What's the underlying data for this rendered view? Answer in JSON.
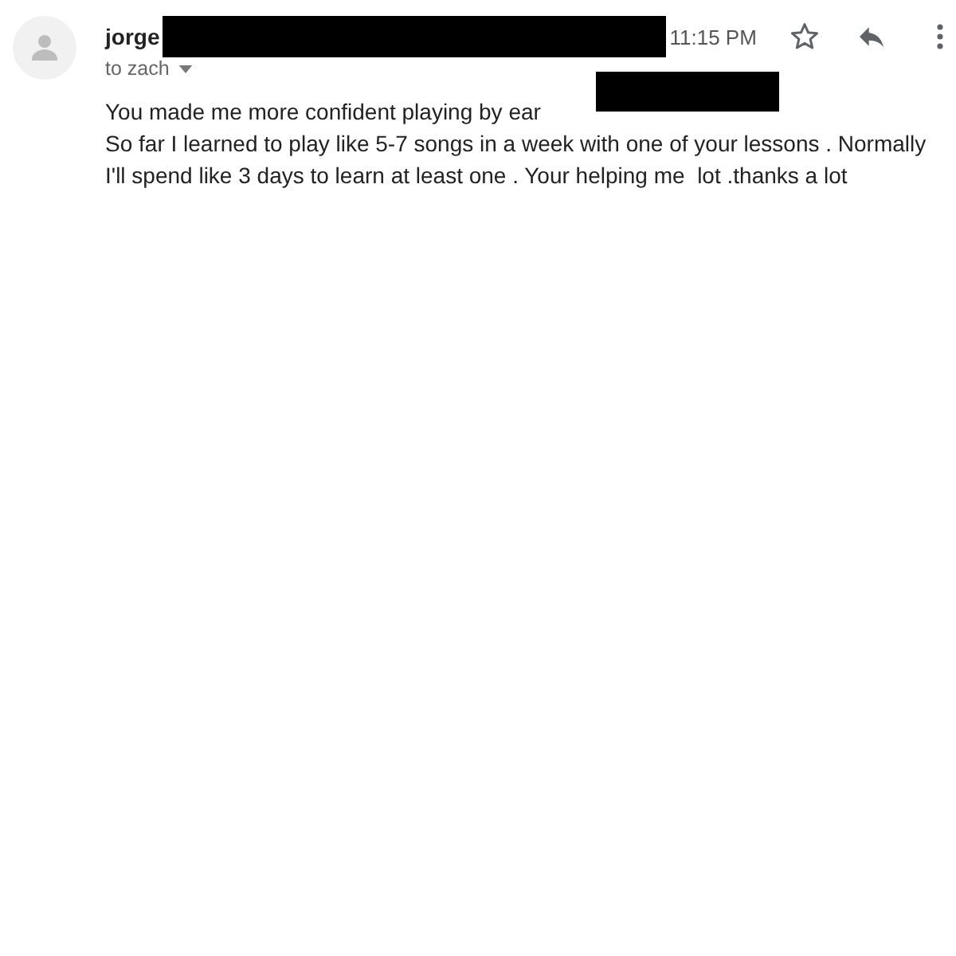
{
  "message": {
    "sender": "jorge",
    "time": "11:15 PM",
    "starred": false,
    "recipient": "to zach",
    "body": [
      "You made me more confident playing by ear",
      "So far I learned to play like 5-7 songs in a week with one of your lessons . Normally I'll spend like 3 days to learn at least one . Your helping me  lot .thanks a lot"
    ]
  }
}
